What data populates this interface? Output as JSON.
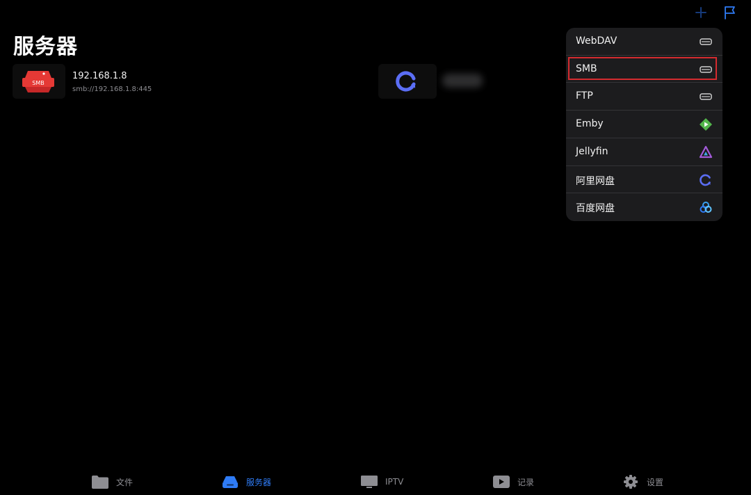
{
  "header": {
    "title": "服务器"
  },
  "servers": [
    {
      "name": "192.168.1.8",
      "url": "smb://192.168.1.8:445",
      "badge": "SMB"
    }
  ],
  "menu": {
    "items": [
      {
        "label": "WebDAV",
        "icon": "drive-icon"
      },
      {
        "label": "SMB",
        "icon": "drive-icon"
      },
      {
        "label": "FTP",
        "icon": "drive-icon"
      },
      {
        "label": "Emby",
        "icon": "emby-icon"
      },
      {
        "label": "Jellyfin",
        "icon": "jellyfin-icon"
      },
      {
        "label": "阿里网盘",
        "icon": "aliyun-icon"
      },
      {
        "label": "百度网盘",
        "icon": "baidu-icon"
      }
    ]
  },
  "tabs": [
    {
      "label": "文件",
      "icon": "folder-icon",
      "active": false
    },
    {
      "label": "服务器",
      "icon": "server-icon",
      "active": true
    },
    {
      "label": "IPTV",
      "icon": "tv-icon",
      "active": false
    },
    {
      "label": "记录",
      "icon": "play-icon",
      "active": false
    },
    {
      "label": "设置",
      "icon": "gear-icon",
      "active": false
    }
  ],
  "colors": {
    "accent": "#2f7cf6",
    "smb_red": "#e53935",
    "highlight_red": "#d52b2f",
    "emby_green": "#52b54b",
    "aliyun_blue": "#5b6ef5"
  }
}
